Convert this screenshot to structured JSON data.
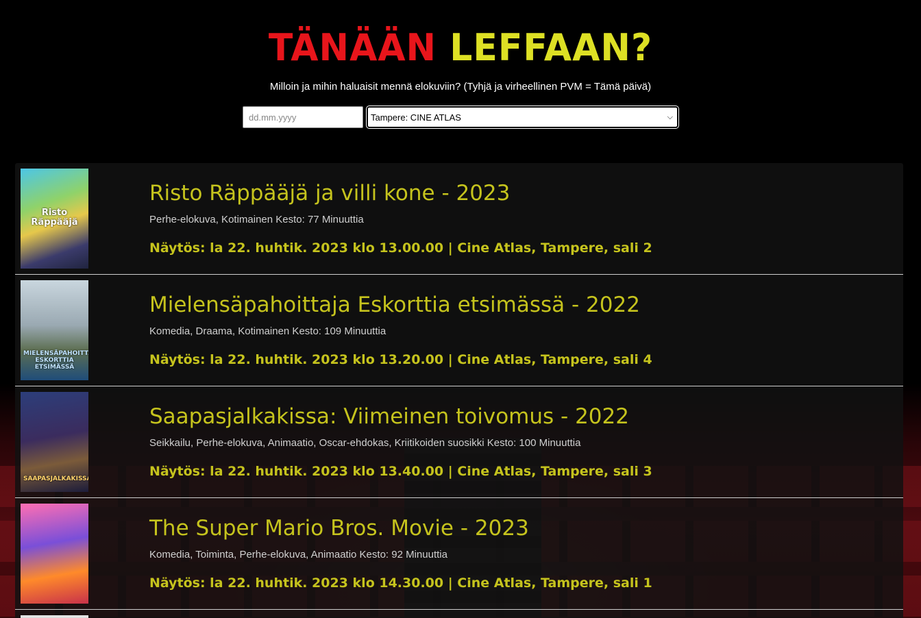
{
  "header": {
    "title_word1": "TÄNÄÄN",
    "title_word2": "LEFFAAN?",
    "subtitle": "Milloin ja mihin haluaisit mennä elokuviin? (Tyhjä ja virheellinen PVM = Tämä päivä)"
  },
  "controls": {
    "date_placeholder": "dd.mm.yyyy",
    "date_value": "",
    "theater_selected": "Tampere: CINE ATLAS"
  },
  "colors": {
    "title_red": "#e8151b",
    "title_yellow": "#dde024",
    "movie_text": "#c5c31d"
  },
  "movies": [
    {
      "title": "Risto Räppääjä ja villi kone - 2023",
      "meta": "Perhe-elokuva, Kotimainen Kesto: 77 Minuuttia",
      "showtime": "Näytös: la 22. huhtik. 2023 klo 13.00.00 | Cine Atlas, Tampere, sali 2",
      "poster_text": "Risto Räppääjä"
    },
    {
      "title": "Mielensäpahoittaja Eskorttia etsimässä - 2022",
      "meta": "Komedia, Draama, Kotimainen Kesto: 109 Minuuttia",
      "showtime": "Näytös: la 22. huhtik. 2023 klo 13.20.00 | Cine Atlas, Tampere, sali 4",
      "poster_text": "MIELENSÄPAHOITTAJA ESKORTTIA ETSIMÄSSÄ"
    },
    {
      "title": "Saapasjalkakissa: Viimeinen toivomus - 2022",
      "meta": "Seikkailu, Perhe-elokuva, Animaatio, Oscar-ehdokas, Kriitikoiden suosikki Kesto: 100 Minuuttia",
      "showtime": "Näytös: la 22. huhtik. 2023 klo 13.40.00 | Cine Atlas, Tampere, sali 3",
      "poster_text": "SAAPASJALKAKISSA"
    },
    {
      "title": "The Super Mario Bros. Movie - 2023",
      "meta": "Komedia, Toiminta, Perhe-elokuva, Animaatio Kesto: 92 Minuuttia",
      "showtime": "Näytös: la 22. huhtik. 2023 klo 14.30.00 | Cine Atlas, Tampere, sali 1",
      "poster_text": ""
    }
  ]
}
